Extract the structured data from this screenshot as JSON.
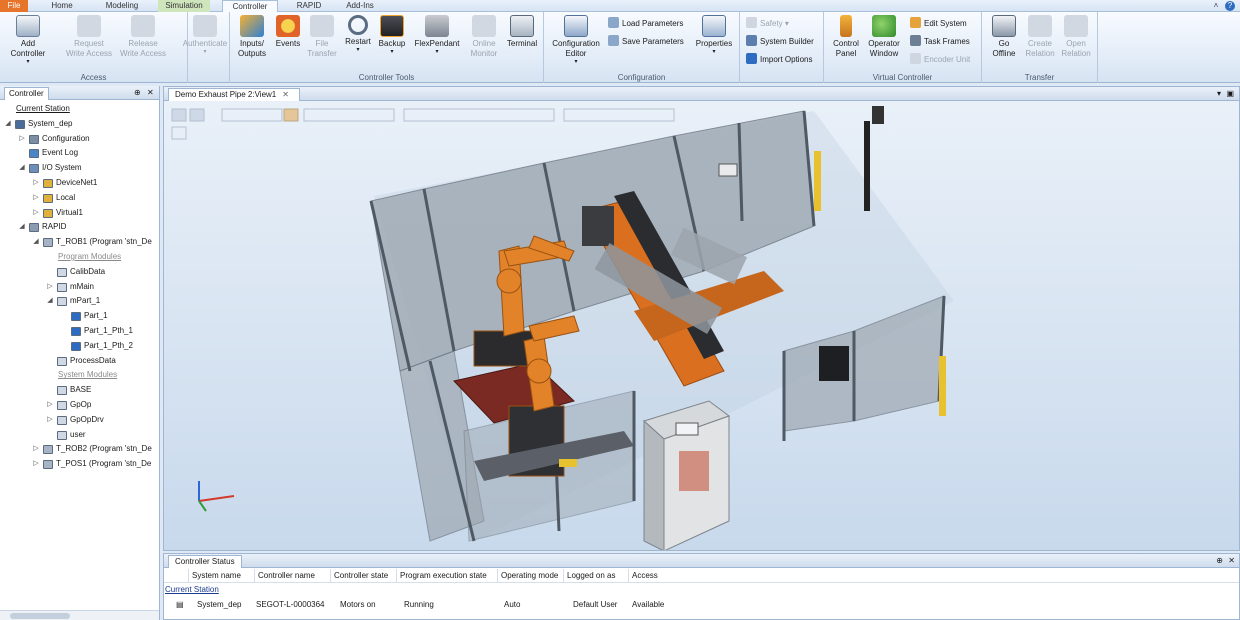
{
  "tabs": [
    "File",
    "Home",
    "Modeling",
    "Simulation",
    "Controller",
    "RAPID",
    "Add-Ins"
  ],
  "active_tab": "Controller",
  "ribbon": {
    "groups": [
      {
        "label": "Access",
        "buttons": [
          {
            "label": "Add\nController",
            "arrow": true,
            "disabled": false,
            "icon": "add-controller-icon"
          },
          {
            "label": "Request\nWrite Access",
            "disabled": true,
            "icon": "request-write-icon"
          },
          {
            "label": "Release\nWrite Access",
            "disabled": true,
            "icon": "release-write-icon"
          },
          {
            "label": "Authenticate",
            "arrow": true,
            "disabled": true,
            "icon": "authenticate-icon"
          }
        ]
      },
      {
        "label": "Controller Tools",
        "buttons": [
          {
            "label": "Inputs/\nOutputs",
            "disabled": false,
            "icon": "inputs-outputs-icon"
          },
          {
            "label": "Events",
            "disabled": false,
            "icon": "events-icon"
          },
          {
            "label": "File\nTransfer",
            "disabled": true,
            "icon": "file-transfer-icon"
          },
          {
            "label": "Restart",
            "arrow": true,
            "disabled": false,
            "icon": "restart-icon"
          },
          {
            "label": "Backup",
            "arrow": true,
            "disabled": false,
            "icon": "backup-icon"
          },
          {
            "label": "FlexPendant",
            "arrow": true,
            "disabled": false,
            "icon": "flexpendant-icon"
          },
          {
            "label": "Online\nMonitor",
            "disabled": true,
            "icon": "online-monitor-icon"
          },
          {
            "label": "Terminal",
            "disabled": false,
            "icon": "terminal-icon"
          }
        ]
      },
      {
        "label": "Configuration",
        "buttons": [
          {
            "label": "Configuration\nEditor",
            "arrow": true,
            "disabled": false,
            "icon": "configuration-editor-icon"
          },
          {
            "label": "Properties",
            "arrow": true,
            "disabled": false,
            "icon": "properties-icon"
          }
        ],
        "small": [
          {
            "label": "Load Parameters",
            "disabled": false,
            "icon": "load-parameters-icon"
          },
          {
            "label": "Save Parameters",
            "disabled": false,
            "icon": "save-parameters-icon"
          }
        ]
      },
      {
        "label": "",
        "small": [
          {
            "label": "Safety",
            "disabled": true,
            "icon": "safety-icon"
          },
          {
            "label": "System Builder",
            "disabled": false,
            "icon": "system-builder-icon"
          },
          {
            "label": "Import Options",
            "disabled": false,
            "icon": "import-options-icon"
          }
        ]
      },
      {
        "label": "Virtual Controller",
        "buttons": [
          {
            "label": "Control\nPanel",
            "disabled": false,
            "icon": "control-panel-icon"
          },
          {
            "label": "Operator\nWindow",
            "disabled": false,
            "icon": "operator-window-icon"
          }
        ],
        "small": [
          {
            "label": "Edit System",
            "disabled": false,
            "icon": "edit-system-icon"
          },
          {
            "label": "Task Frames",
            "disabled": false,
            "icon": "task-frames-icon"
          },
          {
            "label": "Encoder Unit",
            "disabled": true,
            "icon": "encoder-unit-icon"
          }
        ]
      },
      {
        "label": "Transfer",
        "buttons": [
          {
            "label": "Go\nOffline",
            "disabled": false,
            "icon": "go-offline-icon"
          },
          {
            "label": "Create\nRelation",
            "disabled": true,
            "icon": "create-relation-icon"
          },
          {
            "label": "Open\nRelation",
            "disabled": true,
            "icon": "open-relation-icon"
          }
        ]
      }
    ]
  },
  "left_panel": {
    "title": "Controller",
    "tree": [
      {
        "label": "Current Station",
        "depth": 0,
        "kind": "station"
      },
      {
        "label": "System_dep",
        "depth": 0,
        "exp": "open",
        "icon": "controller-icon"
      },
      {
        "label": "Configuration",
        "depth": 1,
        "exp": "closed",
        "icon": "configuration-icon"
      },
      {
        "label": "Event Log",
        "depth": 1,
        "icon": "event-log-icon"
      },
      {
        "label": "I/O System",
        "depth": 1,
        "exp": "open",
        "icon": "io-system-icon"
      },
      {
        "label": "DeviceNet1",
        "depth": 2,
        "exp": "closed",
        "icon": "network-icon"
      },
      {
        "label": "Local",
        "depth": 2,
        "exp": "closed",
        "icon": "network-icon"
      },
      {
        "label": "Virtual1",
        "depth": 2,
        "exp": "closed",
        "icon": "network-icon"
      },
      {
        "label": "RAPID",
        "depth": 1,
        "exp": "open",
        "icon": "rapid-icon"
      },
      {
        "label": "T_ROB1 (Program 'stn_De",
        "depth": 2,
        "exp": "open",
        "icon": "task-icon"
      },
      {
        "label": "Program Modules",
        "depth": 3,
        "kind": "section"
      },
      {
        "label": "CalibData",
        "depth": 3,
        "icon": "module-icon"
      },
      {
        "label": "mMain",
        "depth": 3,
        "exp": "closed",
        "icon": "module-icon"
      },
      {
        "label": "mPart_1",
        "depth": 3,
        "exp": "open",
        "icon": "module-icon"
      },
      {
        "label": "Part_1",
        "depth": 4,
        "icon": "routine-icon"
      },
      {
        "label": "Part_1_Pth_1",
        "depth": 4,
        "icon": "routine-icon"
      },
      {
        "label": "Part_1_Pth_2",
        "depth": 4,
        "icon": "routine-icon"
      },
      {
        "label": "ProcessData",
        "depth": 3,
        "icon": "module-icon"
      },
      {
        "label": "System Modules",
        "depth": 3,
        "kind": "section"
      },
      {
        "label": "BASE",
        "depth": 3,
        "icon": "module-icon"
      },
      {
        "label": "GpOp",
        "depth": 3,
        "exp": "closed",
        "icon": "module-icon"
      },
      {
        "label": "GpOpDrv",
        "depth": 3,
        "exp": "closed",
        "icon": "module-icon"
      },
      {
        "label": "user",
        "depth": 3,
        "icon": "module-icon"
      },
      {
        "label": "T_ROB2 (Program 'stn_De",
        "depth": 2,
        "exp": "closed",
        "icon": "task-icon"
      },
      {
        "label": "T_POS1 (Program 'stn_De",
        "depth": 2,
        "exp": "closed",
        "icon": "task-icon"
      }
    ]
  },
  "document": {
    "tab_title": "Demo Exhaust Pipe 2:View1"
  },
  "status_panel": {
    "title": "Controller Status",
    "columns": [
      "System name",
      "Controller name",
      "Controller state",
      "Program execution state",
      "Operating mode",
      "Logged on as",
      "Access"
    ],
    "station": "Current Station",
    "rows": [
      [
        "System_dep",
        "SEGOT-L-0000364",
        "Motors on",
        "Running",
        "Auto",
        "Default User",
        "Available"
      ]
    ]
  },
  "colors": {
    "accent": "#e6752b",
    "ribbon": "#e1ebf7",
    "robot": "#e2832a",
    "fence": "#9aa4ad"
  }
}
